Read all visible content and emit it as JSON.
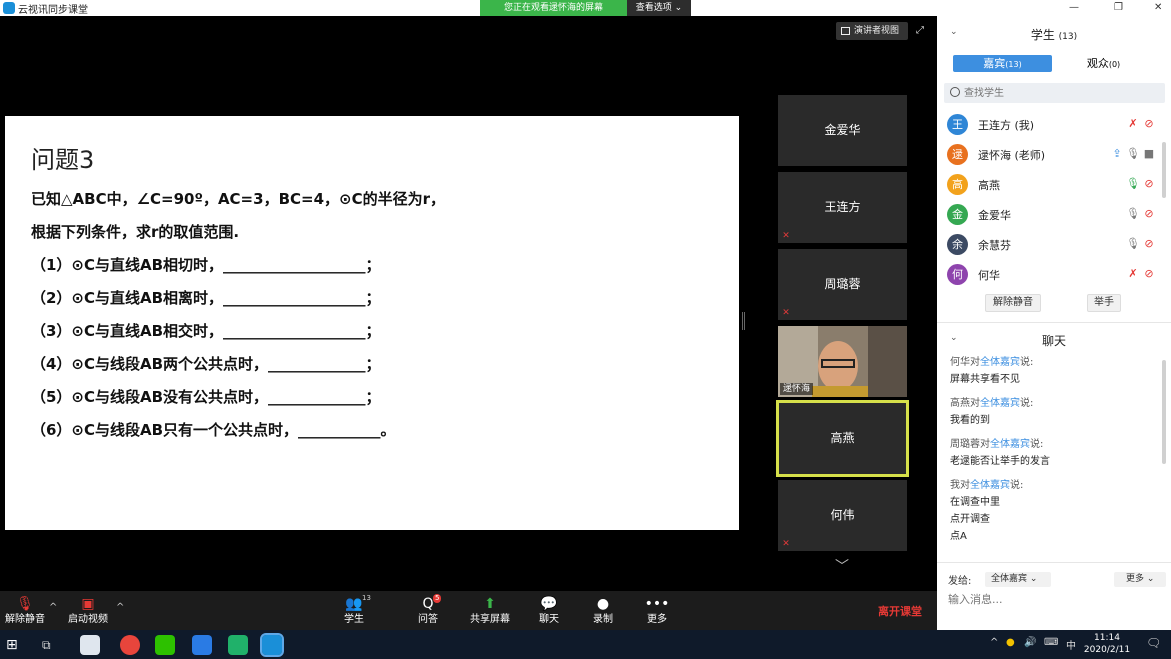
{
  "titlebar": {
    "app_title": "云视讯同步课堂"
  },
  "share_banner": {
    "text": "您正在观看逯怀海的屏幕",
    "options_label": "查看选项 ⌄"
  },
  "stage": {
    "presenter_view_label": "演讲者视图",
    "slide": {
      "title": "问题3",
      "lines": [
        "已知△ABC中，∠C=90º，AC=3，BC=4，⊙C的半径为r，",
        "根据下列条件，求r的取值范围.",
        "（1）⊙C与直线AB相切时，___________________；",
        "（2）⊙C与直线AB相离时，___________________；",
        "（3）⊙C与直线AB相交时，___________________；",
        "（4）⊙C与线段AB两个公共点时，_____________；",
        "（5）⊙C与线段AB没有公共点时，_____________；",
        "（6）⊙C与线段AB只有一个公共点时，___________。"
      ]
    },
    "video_tiles": [
      {
        "name": "金爱华",
        "muted": false
      },
      {
        "name": "王连方",
        "muted": true
      },
      {
        "name": "周璐蓉",
        "muted": true
      },
      {
        "name": "逯怀海",
        "muted": false,
        "video": true
      },
      {
        "name": "高燕",
        "muted": false,
        "active": true
      },
      {
        "name": "何伟",
        "muted": true
      }
    ]
  },
  "toolbar": {
    "unmute": "解除静音",
    "start_video": "启动视频",
    "students": "学生",
    "students_count": "13",
    "qa": "问答",
    "qa_badge": "5",
    "share_screen": "共享屏幕",
    "chat": "聊天",
    "record": "录制",
    "more": "更多",
    "leave": "离开课堂"
  },
  "panel": {
    "students_header": "学生",
    "students_count": "(13)",
    "tabs": [
      {
        "label": "嘉宾",
        "count": "(13)"
      },
      {
        "label": "观众",
        "count": "(0)"
      }
    ],
    "search_placeholder": "查找学生",
    "members": [
      {
        "avatar": "王",
        "color": "#2f86d6",
        "name": "王连方 (我)",
        "mic": "off",
        "cam": "off",
        "share": false
      },
      {
        "avatar": "逯",
        "color": "#e8711f",
        "name": "逯怀海 (老师)",
        "mic": "idle",
        "cam": "idle",
        "share": true
      },
      {
        "avatar": "高",
        "color": "#f2a21c",
        "name": "高燕",
        "mic": "on",
        "cam": "off",
        "share": false
      },
      {
        "avatar": "金",
        "color": "#35a852",
        "name": "金爱华",
        "mic": "idle",
        "cam": "off",
        "share": false
      },
      {
        "avatar": "余",
        "color": "#3c4a63",
        "name": "余慧芬",
        "mic": "idle",
        "cam": "off",
        "share": false
      },
      {
        "avatar": "何",
        "color": "#8e44ad",
        "name": "何华",
        "mic": "off",
        "cam": "off",
        "share": false
      }
    ],
    "unmute_button": "解除静音",
    "raise_hand_button": "举手",
    "chat_header": "聊天",
    "chat_messages": [
      {
        "from": "何华对",
        "to": "全体嘉宾",
        "suffix": "说:",
        "lines": [
          "屏幕共享看不见"
        ]
      },
      {
        "from": "高燕对",
        "to": "全体嘉宾",
        "suffix": "说:",
        "lines": [
          "我看的到"
        ]
      },
      {
        "from": "周璐蓉对",
        "to": "全体嘉宾",
        "suffix": "说:",
        "lines": [
          "老逯能否让举手的发言"
        ]
      },
      {
        "from": "我对",
        "to": "全体嘉宾",
        "suffix": "说:",
        "lines": [
          "在调查中里",
          "点开调查",
          "点A"
        ]
      }
    ],
    "send_to_label": "发给:",
    "send_to_value": "全体嘉宾 ⌄",
    "more_label": "更多 ⌄",
    "message_placeholder": "输入消息..."
  },
  "taskbar": {
    "time": "11:14",
    "date": "2020/2/11",
    "ime": "中"
  }
}
